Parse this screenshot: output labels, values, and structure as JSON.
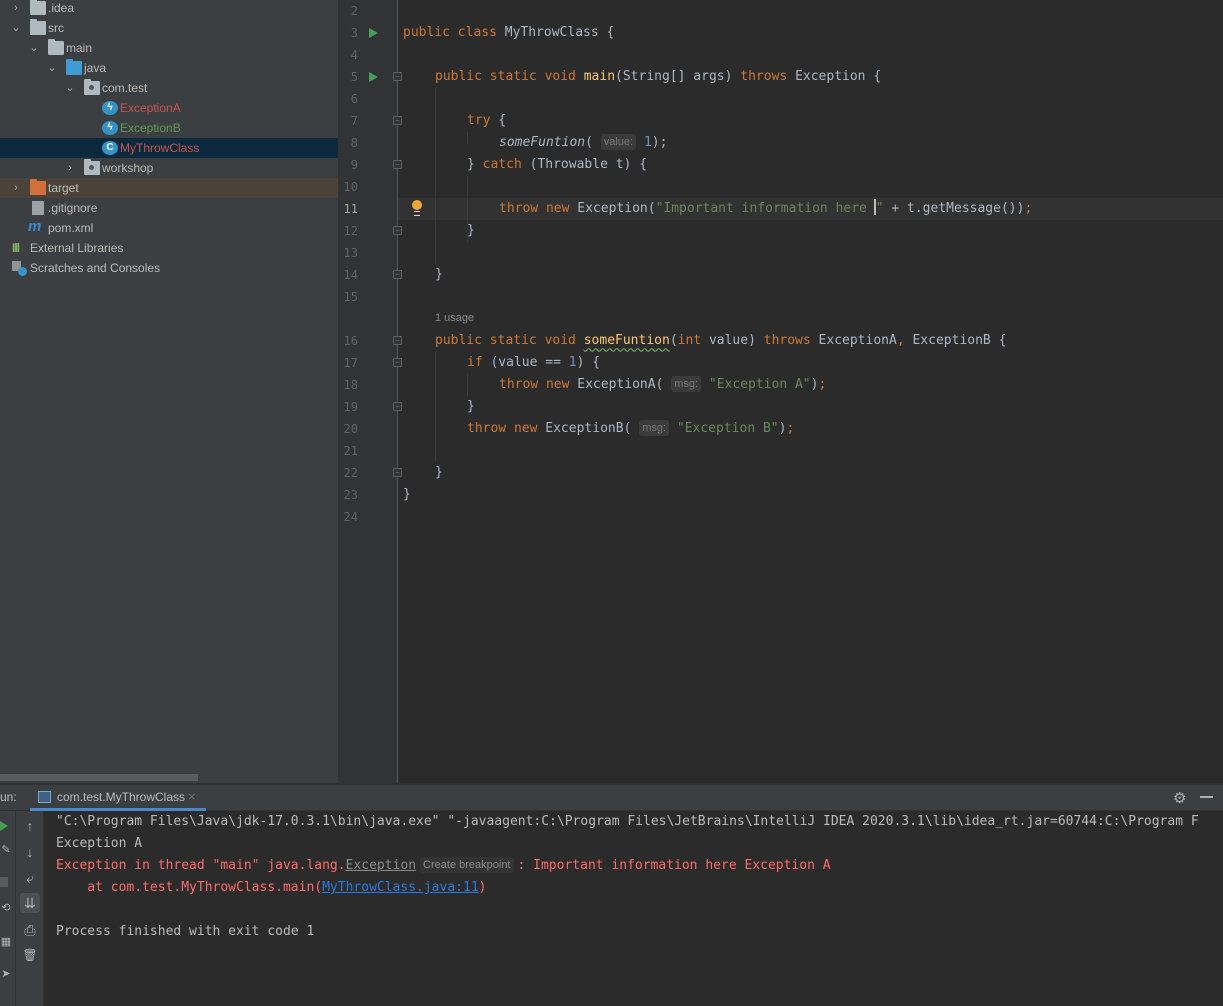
{
  "project_tree": {
    "items": [
      {
        "label": ".idea",
        "type": "folder",
        "expanded": false,
        "depth": 0
      },
      {
        "label": "src",
        "type": "folder",
        "expanded": true,
        "depth": 0
      },
      {
        "label": "main",
        "type": "folder",
        "expanded": true,
        "depth": 1
      },
      {
        "label": "java",
        "type": "source-folder",
        "expanded": true,
        "depth": 2
      },
      {
        "label": "com.test",
        "type": "package",
        "expanded": true,
        "depth": 3
      },
      {
        "label": "ExceptionA",
        "type": "exception-class",
        "status": "modified-error",
        "color": "#c75450",
        "depth": 4
      },
      {
        "label": "ExceptionB",
        "type": "exception-class",
        "status": "added",
        "color": "#629755",
        "depth": 4
      },
      {
        "label": "MyThrowClass",
        "type": "runnable-class",
        "status": "selected",
        "color": "#c75450",
        "depth": 4
      },
      {
        "label": "workshop",
        "type": "package",
        "expanded": false,
        "depth": 3
      },
      {
        "label": "target",
        "type": "excluded-folder",
        "expanded": false,
        "depth": 0
      },
      {
        "label": ".gitignore",
        "type": "ignore-file",
        "depth": 0
      },
      {
        "label": "pom.xml",
        "type": "maven-file",
        "depth": 0
      },
      {
        "label": "External Libraries",
        "type": "libraries",
        "depth": -1
      },
      {
        "label": "Scratches and Consoles",
        "type": "scratches",
        "depth": -1
      }
    ]
  },
  "editor": {
    "current_line": 11,
    "usage_hint": "1 usage",
    "line_numbers": [
      "2",
      "3",
      "4",
      "5",
      "6",
      "7",
      "8",
      "9",
      "10",
      "11",
      "12",
      "13",
      "14",
      "15",
      "16",
      "17",
      "18",
      "19",
      "20",
      "21",
      "22",
      "23",
      "24"
    ],
    "code": {
      "l3_kw": "public class ",
      "l3_name": "MyThrowClass {",
      "l5_kw": "public static void ",
      "l5_fn": "main",
      "l5_args": "(String[] args) ",
      "l5_throws": "throws ",
      "l5_rest": "Exception {",
      "l7_kw": "try",
      "l7_rest": " {",
      "l8_fn": "someFuntion",
      "l8_paren": "(",
      "l8_hint": "value:",
      "l8_num": "1",
      "l8_end": ");",
      "l9_a": "} ",
      "l9_kw": "catch",
      "l9_rest": " (Throwable t) {",
      "l11_kw": "throw new ",
      "l11_cls": "Exception(",
      "l11_str1": "\"Important information here ",
      "l11_str2": "\"",
      "l11_rest": " + t.getMessage())",
      "l11_semi": ";",
      "l12": "}",
      "l14": "}",
      "l16_kw": "public static void ",
      "l16_fn": "someFuntion",
      "l16_open": "(",
      "l16_int": "int",
      "l16_args": " value) ",
      "l16_throws": "throws ",
      "l16_a": "ExceptionA",
      "l16_comma": ", ",
      "l16_b": "ExceptionB {",
      "l17_kw": "if",
      "l17_a": " (value == ",
      "l17_num": "1",
      "l17_b": ") {",
      "l18_kw": "throw new ",
      "l18_cls": "ExceptionA(",
      "l18_hint": "msg:",
      "l18_str": "\"Exception A\"",
      "l18_end": ")",
      "l18_semi": ";",
      "l19": "}",
      "l20_kw": "throw new ",
      "l20_cls": "ExceptionB(",
      "l20_hint": "msg:",
      "l20_str": "\"Exception B\"",
      "l20_end": ")",
      "l20_semi": ";",
      "l22": "}",
      "l23": "}"
    }
  },
  "run_panel": {
    "label": "un:",
    "tab_label": "com.test.MyThrowClass",
    "close_glyph": "×",
    "gear_glyph": "⚙",
    "console": {
      "command": "\"C:\\Program Files\\Java\\jdk-17.0.3.1\\bin\\java.exe\" \"-javaagent:C:\\Program Files\\JetBrains\\IntelliJ IDEA 2020.3.1\\lib\\idea_rt.jar=60744:C:\\Program F",
      "stdout_line": "Exception A",
      "error_prefix": "Exception in thread \"main\" java.lang.",
      "error_exception_link": "Exception",
      "create_breakpoint": "Create breakpoint",
      "error_suffix": ": Important information here Exception A",
      "stack_prefix": "    at com.test.MyThrowClass.main(",
      "stack_link": "MyThrowClass.java:11",
      "stack_suffix": ")",
      "exit_line": "Process finished with exit code 1"
    },
    "tools": {
      "up": "↑",
      "down": "↓",
      "wrap": "⤶",
      "scroll_end": "⇊",
      "print": "⎙",
      "trash": "🗑"
    }
  }
}
